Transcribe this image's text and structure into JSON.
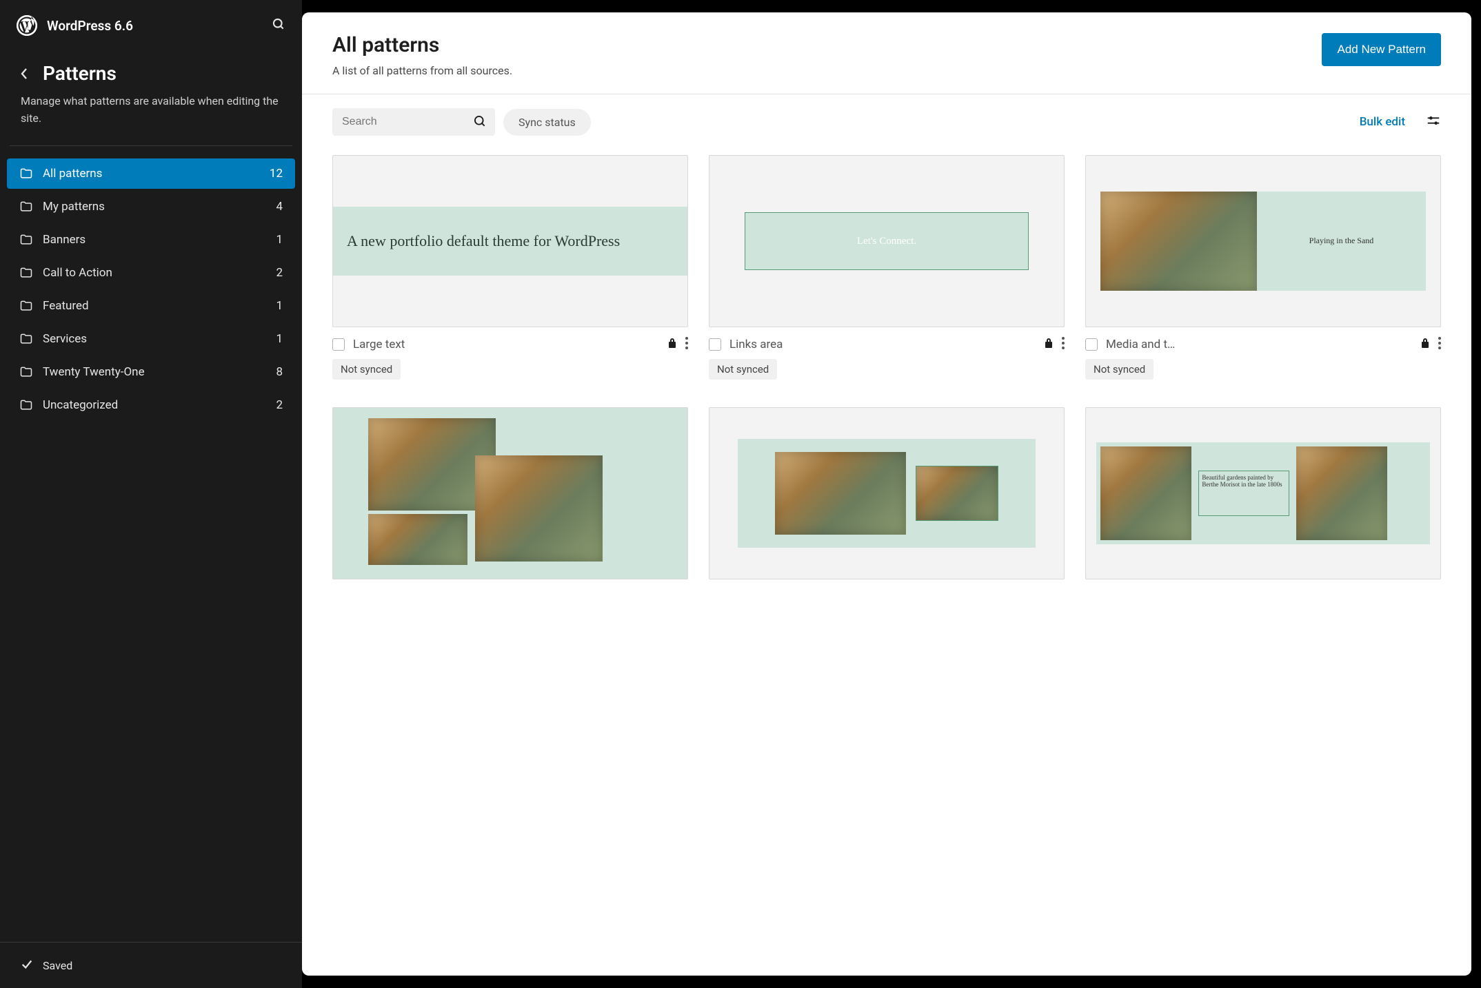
{
  "brand": {
    "title": "WordPress 6.6"
  },
  "section": {
    "title": "Patterns",
    "description": "Manage what patterns are available when editing the site."
  },
  "categories": [
    {
      "label": "All patterns",
      "count": 12,
      "active": true
    },
    {
      "label": "My patterns",
      "count": 4
    },
    {
      "label": "Banners",
      "count": 1
    },
    {
      "label": "Call to Action",
      "count": 2
    },
    {
      "label": "Featured",
      "count": 1
    },
    {
      "label": "Services",
      "count": 1
    },
    {
      "label": "Twenty Twenty-One",
      "count": 8
    },
    {
      "label": "Uncategorized",
      "count": 2
    }
  ],
  "footer": {
    "saved_label": "Saved"
  },
  "main": {
    "title": "All patterns",
    "subtitle": "A list of all patterns from all sources.",
    "add_button": "Add New Pattern",
    "search_placeholder": "Search",
    "sync_chip": "Sync status",
    "bulk_edit": "Bulk edit"
  },
  "cards": [
    {
      "title": "Large text",
      "status": "Not synced",
      "locked": true,
      "preview_text": "A new portfolio default theme for WordPress"
    },
    {
      "title": "Links area",
      "status": "Not synced",
      "locked": true,
      "preview_text": "Let's Connect."
    },
    {
      "title": "Media and t…",
      "status": "Not synced",
      "locked": true,
      "preview_text": "Playing in the Sand"
    },
    {
      "title": "",
      "status": "",
      "locked": false,
      "preview_text": ""
    },
    {
      "title": "",
      "status": "",
      "locked": false,
      "preview_text": ""
    },
    {
      "title": "",
      "status": "",
      "locked": false,
      "preview_text": "Beautiful gardens painted by Berthe Morisot in the late 1800s"
    }
  ]
}
